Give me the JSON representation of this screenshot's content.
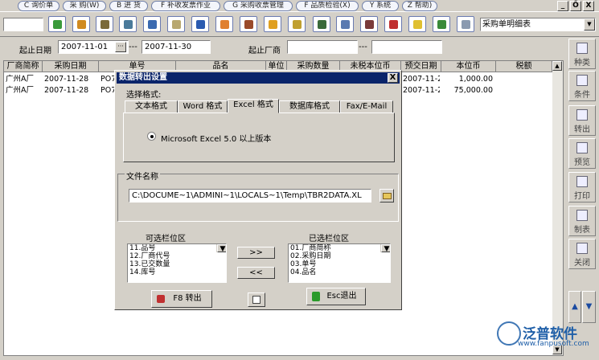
{
  "menu": {
    "items": [
      "C 询价单",
      "采 购(W)",
      "B 进 货",
      "F 补收发票作业",
      "G 采购收票管理",
      "F 品质检验(X)",
      "Y 系统",
      "Z 帮助)"
    ]
  },
  "window_controls": {
    "minimize": "_",
    "restore": "Ő",
    "close": "X"
  },
  "toolbar": {
    "report_select": "采购单明细表",
    "icon_names": [
      "refresh-icon",
      "query-icon",
      "export-icon",
      "view-icon",
      "book-icon",
      "screen-icon",
      "paint-icon",
      "print-icon",
      "transfer-icon",
      "hand-icon",
      "calc-icon",
      "copy-icon",
      "cut-icon",
      "globe-icon",
      "bell-icon",
      "exit-icon",
      "window-icon"
    ]
  },
  "filter": {
    "date_label": "起止日期",
    "date_from": "2007-11-01",
    "date_sep": "---",
    "date_to": "2007-11-30",
    "vendor_label": "起止厂商",
    "vendor_from": "",
    "vendor_sep": "---",
    "vendor_to": ""
  },
  "grid": {
    "columns": [
      "厂商简称",
      "采购日期",
      "单号",
      "品名",
      "单位",
      "采购数量",
      "未税本位币",
      "预交日期",
      "本位币",
      "税额"
    ],
    "rows": [
      [
        "广州A厂",
        "2007-11-28",
        "PO7",
        "",
        "",
        "",
        "",
        "2007-11-2",
        "1,000.00",
        ""
      ],
      [
        "广州A厂",
        "2007-11-28",
        "PO7",
        "",
        "",
        "",
        "",
        "2007-11-2",
        "75,000.00",
        ""
      ]
    ]
  },
  "side_panel": {
    "buttons": [
      "种类",
      "条件",
      "转出",
      "预览",
      "打印",
      "制表",
      "关闭"
    ]
  },
  "dialog": {
    "title": "数据转出设置",
    "close": "X",
    "format_label": "选择格式:",
    "tabs": [
      "文本格式",
      "Word 格式",
      "Excel 格式",
      "数据库格式",
      "Fax/E-Mail"
    ],
    "active_tab": "Excel 格式",
    "excel_option": "Microsoft Excel 5.0 以上版本",
    "file_group_label": "文件名称",
    "file_path": "C:\\DOCUME~1\\ADMINI~1\\LOCALS~1\\Temp\\TBR2DATA.XL",
    "available_label": "可选栏位区",
    "available_fields": [
      "11.品号",
      "12.厂商代号",
      "13.已交数量",
      "14.库号"
    ],
    "selected_label": "已选栏位区",
    "selected_fields": [
      "01.厂商简称",
      "02.采购日期",
      "03.单号",
      "04.品名"
    ],
    "add_btn": ">>",
    "remove_btn": "<<",
    "export_btn": "F8 转出",
    "exit_btn": "Esc退出"
  },
  "watermark": {
    "brand": "泛普软件",
    "url": "www.fanpusoft.com"
  },
  "colors": {
    "title_bar": "#0a246a",
    "menu_border": "#6f7fa8",
    "watermark": "#1f5fa8"
  }
}
